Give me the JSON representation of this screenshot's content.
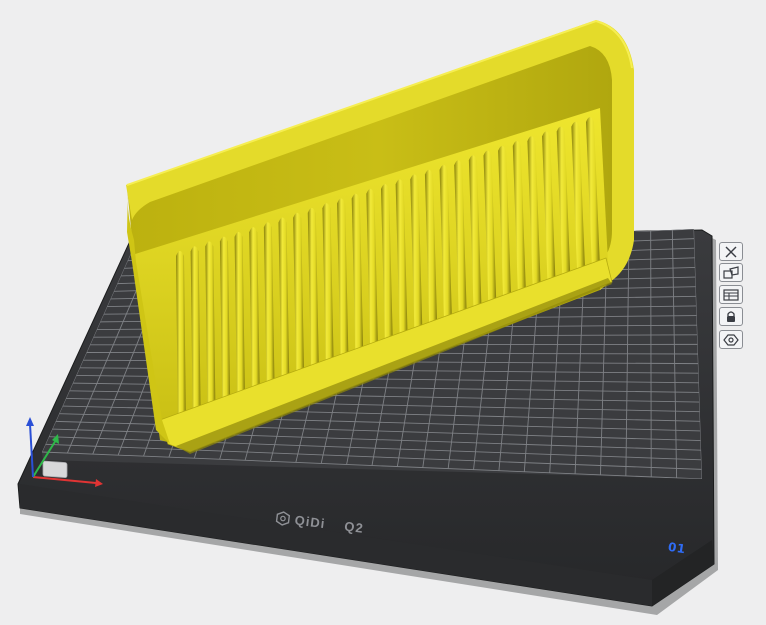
{
  "viewport": {
    "background": "#eeeeef"
  },
  "plate": {
    "brand_logo": "QiDi",
    "model": "Q2",
    "plate_number": "01",
    "surface_color": "#3b3c3f",
    "grid_color": "#8b8d92",
    "frame_color": "#2b2c2e"
  },
  "model": {
    "name": "comb",
    "color": "#d8cf1c"
  },
  "plate_toolbar": [
    {
      "id": "delete",
      "icon": "close-icon",
      "tooltip": ""
    },
    {
      "id": "arrange",
      "icon": "arrange-icon",
      "tooltip": ""
    },
    {
      "id": "orient",
      "icon": "plate-settings-icon",
      "tooltip": ""
    },
    {
      "id": "lock",
      "icon": "lock-icon",
      "tooltip": ""
    },
    {
      "id": "settings",
      "icon": "gear-icon",
      "tooltip": ""
    }
  ],
  "axes": {
    "x_color": "#e03434",
    "y_color": "#2fb84a",
    "z_color": "#2a4fd6"
  }
}
